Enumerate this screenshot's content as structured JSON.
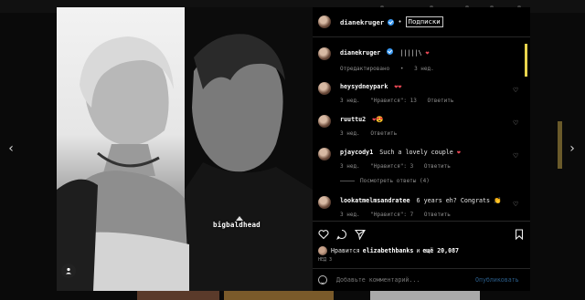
{
  "header": {
    "username": "dianekruger",
    "separator": "•",
    "follow_label": "Подписки"
  },
  "caption": {
    "username": "dianekruger",
    "text": "|||||\\",
    "edited_label": "Отредактировано",
    "age": "3 нед."
  },
  "comments": [
    {
      "username": "heysydneypark",
      "text": "",
      "emoji": "❤❤",
      "age": "3 нед.",
      "likes": "\"Нравится\": 13",
      "reply": "Ответить"
    },
    {
      "username": "ruuttu2",
      "text": "",
      "emoji": "❤😍",
      "age": "3 нед.",
      "likes": "",
      "reply": "Ответить"
    },
    {
      "username": "pjaycody1",
      "text": "Such a lovely couple",
      "emoji": "❤",
      "age": "3 нед.",
      "likes": "\"Нравится\": 3",
      "reply": "Ответить"
    },
    {
      "username": "lookatmelmsandratee",
      "text": "6 years eh? Congrats",
      "emoji": "👏",
      "age": "3 нед.",
      "likes": "\"Нравится\": 7",
      "reply": "Ответить"
    }
  ],
  "view_replies": "Посмотреть ответы (4)",
  "photo": {
    "tag_username": "bigbaldhead"
  },
  "likes": {
    "prefix": "Нравится",
    "user": "elizabethbanks",
    "mid": "и",
    "count": "ещё 20,087"
  },
  "post_age": "НЕД 3",
  "composer": {
    "placeholder": "Добавьте комментарий...",
    "post_label": "Опубликовать"
  },
  "icons": {
    "prev": "chevron-left-icon",
    "next": "chevron-right-icon",
    "like": "heart-icon",
    "comment": "comment-icon",
    "share": "paper-plane-icon",
    "save": "bookmark-icon",
    "emoji": "smiley-icon",
    "people": "user-tag-icon"
  },
  "colors": {
    "accent": "#3897f0",
    "like_red": "#ed4956",
    "scroll_thumb": "#e8d44d"
  }
}
